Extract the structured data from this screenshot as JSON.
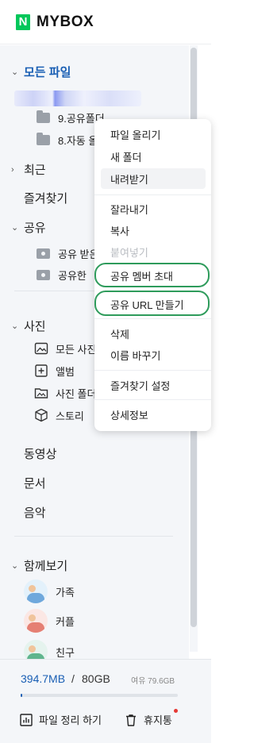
{
  "header": {
    "logo_letter": "N",
    "logo_text": "MYBOX"
  },
  "sidebar": {
    "all_files": "모든 파일",
    "folders": [
      {
        "name": "9.공유폴더"
      },
      {
        "name": "8.자동 올"
      }
    ],
    "recent": "최근",
    "favorites": "즐겨찾기",
    "shared": "공유",
    "shared_items": [
      {
        "name": "공유 받은"
      },
      {
        "name": "공유한"
      }
    ],
    "photos": "사진",
    "photo_items": [
      {
        "name": "모든 사진",
        "icon": "image-icon"
      },
      {
        "name": "앨범",
        "icon": "album-icon"
      },
      {
        "name": "사진 폴더",
        "icon": "photo-folder-icon"
      },
      {
        "name": "스토리",
        "icon": "story-cube-icon"
      }
    ],
    "videos": "동영상",
    "documents": "문서",
    "music": "음악",
    "together": "함께보기",
    "together_items": [
      {
        "name": "가족"
      },
      {
        "name": "커플"
      },
      {
        "name": "친구"
      }
    ]
  },
  "storage": {
    "used": "394.7MB",
    "separator": "/",
    "total": "80GB",
    "remaining": "여유 79.6GB",
    "used_fraction": 0.005
  },
  "bottom_actions": {
    "organize": "파일 정리 하기",
    "trash": "휴지통"
  },
  "context_menu": {
    "items": [
      {
        "label": "파일 올리기"
      },
      {
        "label": "새 폴더"
      },
      {
        "label": "내려받기"
      },
      {
        "label": "잘라내기"
      },
      {
        "label": "복사"
      },
      {
        "label": "붙여넣기"
      },
      {
        "label": "공유 멤버 초대"
      },
      {
        "label": "공유 URL 만들기"
      },
      {
        "label": "삭제"
      },
      {
        "label": "이름 바꾸기"
      },
      {
        "label": "즐겨찾기 설정"
      },
      {
        "label": "상세정보"
      }
    ]
  },
  "colors": {
    "brand": "#03c75a",
    "accent": "#1a5fb4",
    "highlight": "#2e9b5b"
  }
}
